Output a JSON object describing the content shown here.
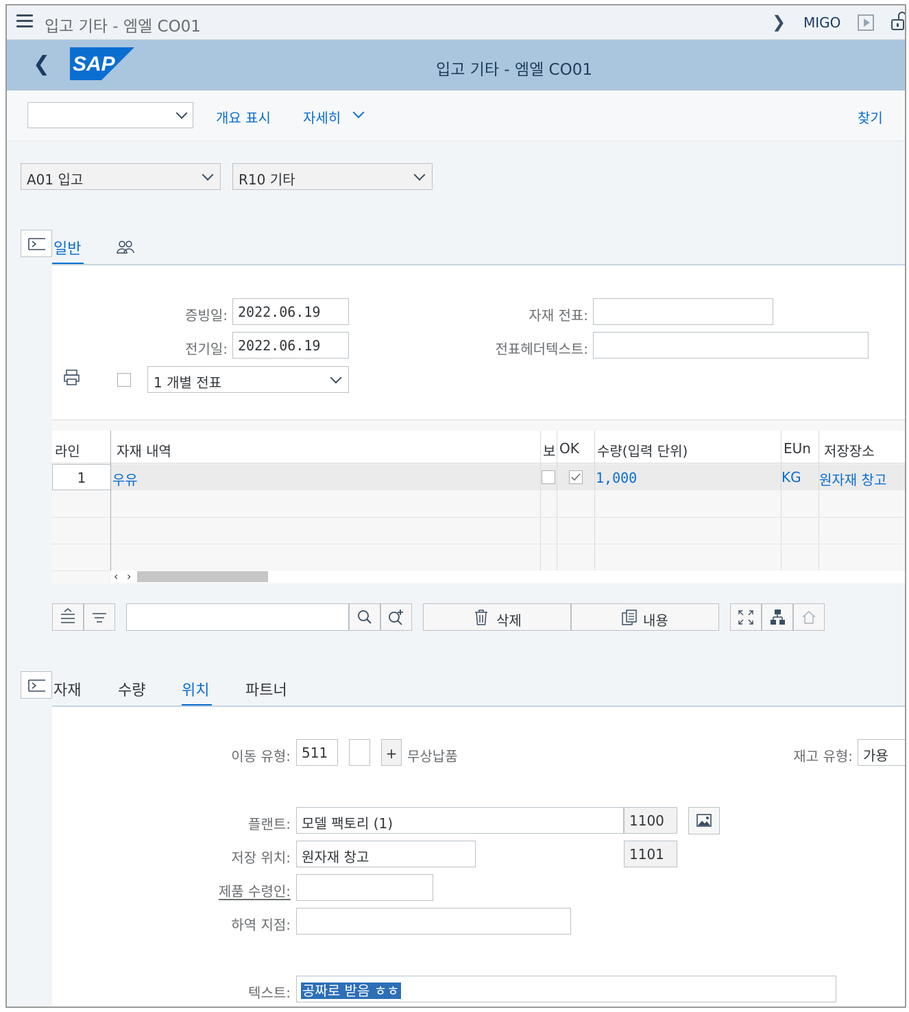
{
  "window": {
    "title": "입고 기타 - 엠엘 CO01",
    "tcode": "MIGO"
  },
  "shell": {
    "title": "입고 기타 - 엠엘 CO01",
    "logo": "SAP"
  },
  "toolbar": {
    "select_value": "",
    "overview_label": "개요 표시",
    "detail_label": "자세히",
    "find_label": "찾기"
  },
  "header": {
    "action": "A01 입고",
    "reference": "R10 기타"
  },
  "general_tabs": {
    "tab1": "일반",
    "tab2_icon": "persons-icon"
  },
  "general": {
    "doc_date_label": "증빙일:",
    "doc_date": "2022.06.19",
    "post_date_label": "전기일:",
    "post_date": "2022.06.19",
    "material_doc_label": "자재 전표:",
    "material_doc": "",
    "header_text_label": "전표헤더텍스트:",
    "header_text": "",
    "print_option": "1 개별 전표"
  },
  "items_table": {
    "columns": [
      "라인",
      "자재 내역",
      "보",
      "OK",
      "수량(입력 단위)",
      "EUn",
      "저장장소"
    ],
    "rows": [
      {
        "line": "1",
        "material": "우유",
        "hold": false,
        "ok": true,
        "qty": "1,000",
        "unit": "KG",
        "sloc": "원자재 창고"
      }
    ]
  },
  "item_toolbar": {
    "search_value": "",
    "delete_label": "삭제",
    "content_label": "내용"
  },
  "detail_tabs": {
    "tab1": "자재",
    "tab2": "수량",
    "tab3": "위치",
    "tab4": "파트너"
  },
  "detail": {
    "movement_type_label": "이동 유형:",
    "movement_type": "511",
    "movement_special": "",
    "movement_sign": "+",
    "movement_text": "무상납품",
    "stock_type_label": "재고 유형:",
    "stock_type": "가용",
    "plant_label": "플랜트:",
    "plant_name": "모델 팩토리 (1)",
    "plant_code": "1100",
    "sloc_label": "저장 위치:",
    "sloc_name": "원자재 창고",
    "sloc_code": "1101",
    "goods_recipient_label": "제품 수령인:",
    "goods_recipient": "",
    "unloading_point_label": "하역 지점:",
    "unloading_point": "",
    "text_label": "텍스트:",
    "text": "공짜로 받음 ㅎㅎ"
  }
}
